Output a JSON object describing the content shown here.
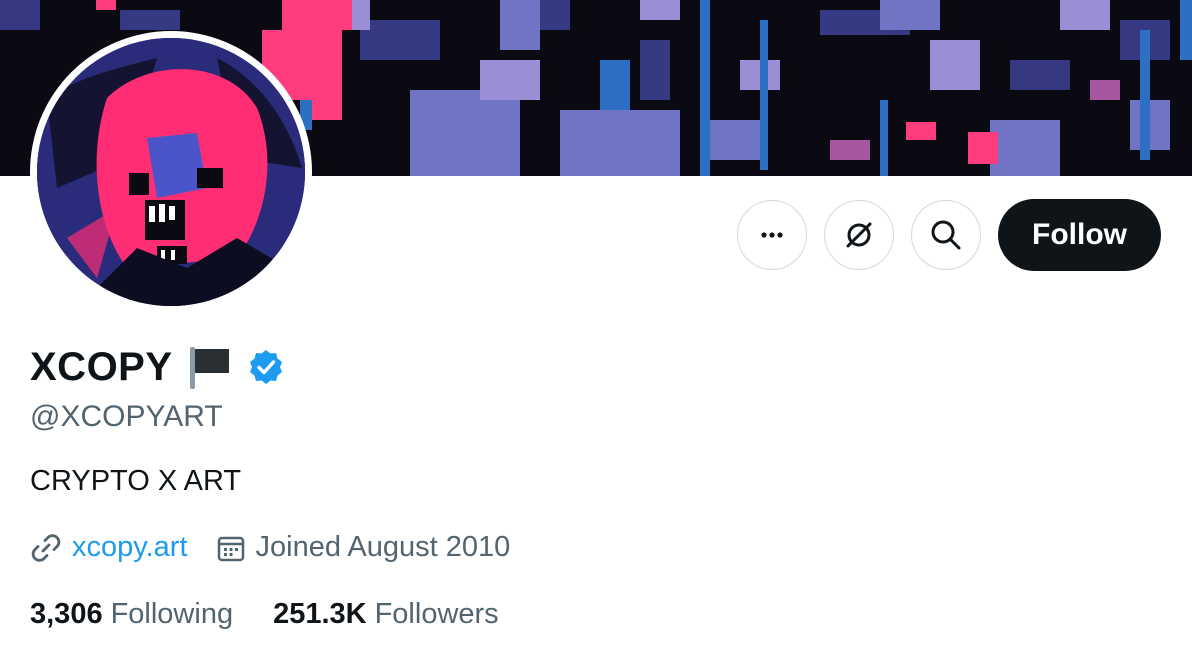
{
  "profile": {
    "display_name": "XCOPY",
    "handle": "@XCOPYART",
    "bio": "CRYPTO X ART",
    "website": "xcopy.art",
    "joined": "Joined August 2010",
    "verified": true
  },
  "stats": {
    "following_count": "3,306",
    "following_label": "Following",
    "followers_count": "251.3K",
    "followers_label": "Followers"
  },
  "actions": {
    "more_icon": "more-horizontal-icon",
    "grok_icon": "grok-icon",
    "search_icon": "search-icon",
    "follow_label": "Follow"
  },
  "colors": {
    "accent": "#1d9bf0",
    "verified_badge": "#1d9bf0",
    "follow_button_bg": "#0f1419",
    "secondary_text": "#536471"
  }
}
